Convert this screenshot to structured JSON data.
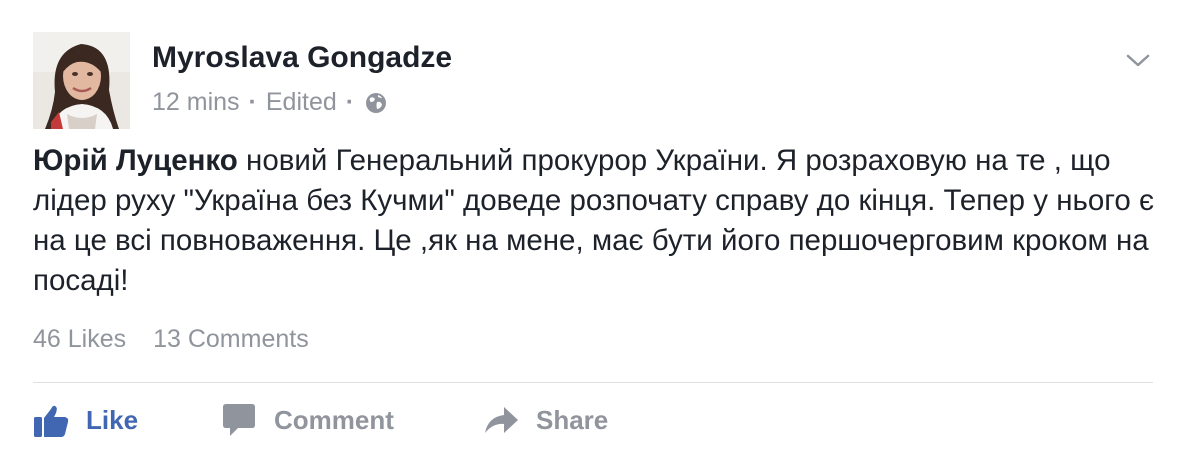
{
  "post": {
    "author": "Myroslava Gongadze",
    "time": "12 mins",
    "edited": "Edited",
    "meta_separator": "·",
    "body_bold": "Юрій Луценко",
    "body_rest": " новий Генеральний прокурор України. Я розраховую на те , що лідер руху \"Україна без Кучми\" доведе розпочату справу до кінця. Тепер у нього є на це всі повноваження. Це ,як на мене, має бути його першочерговим кроком на посаді!",
    "likes": "46 Likes",
    "comments": "13 Comments"
  },
  "actions": {
    "like": "Like",
    "comment": "Comment",
    "share": "Share"
  },
  "colors": {
    "author": "#1d2129",
    "meta": "#90949c",
    "like_blue": "#4267b2",
    "divider": "#dddfe2"
  },
  "icons": {
    "audience": "globe-icon",
    "menu": "chevron-down-icon",
    "like": "thumbs-up-icon",
    "comment": "speech-bubble-icon",
    "share": "share-arrow-icon"
  }
}
